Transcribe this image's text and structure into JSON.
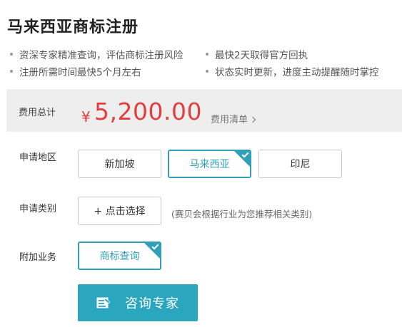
{
  "page": {
    "title": "马来西亚商标注册"
  },
  "features": [
    "资深专家精准查询，评估商标注册风险",
    "最快2天取得官方回执",
    "注册所需时间最快5个月左右",
    "状态实时更新，进度主动提醒随时掌控"
  ],
  "price": {
    "label": "费用总计",
    "currency": "¥",
    "amount": "5,200.00",
    "details_link": "费用清单"
  },
  "region": {
    "label": "申请地区",
    "options": [
      "新加坡",
      "马来西亚",
      "印尼"
    ],
    "selected": "马来西亚"
  },
  "category": {
    "label": "申请类别",
    "button": "+ 点击选择",
    "hint": "(赛贝会根据行业为您推荐相关类别)"
  },
  "addon": {
    "label": "附加业务",
    "option": "商标查询",
    "selected": true
  },
  "cta": {
    "label": "咨询专家",
    "icon": "edit-form-icon"
  },
  "colors": {
    "accent": "#2fa0b8",
    "price": "#e33d3d",
    "cta_bg": "#2aa6bf"
  }
}
